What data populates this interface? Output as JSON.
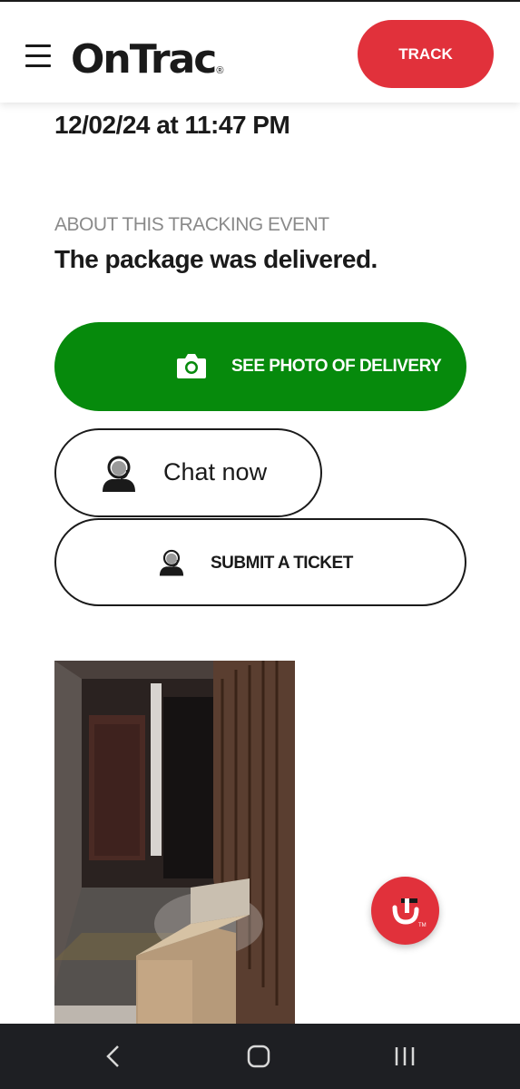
{
  "header": {
    "logo_text": "OnTrac",
    "logo_mark": "®",
    "track_label": "TRACK",
    "menu_icon": "hamburger-menu-icon"
  },
  "event": {
    "timestamp": "12/02/24 at 11:47 PM",
    "about_label": "ABOUT THIS TRACKING EVENT",
    "description": "The package was delivered."
  },
  "actions": {
    "photo_label": "SEE PHOTO OF DELIVERY",
    "photo_icon": "camera-icon",
    "chat_label": "Chat now",
    "chat_icon": "support-agent-icon",
    "ticket_label": "SUBMIT A TICKET",
    "ticket_icon": "support-agent-icon"
  },
  "colors": {
    "brand_red": "#e1313b",
    "green": "#068a0c",
    "text": "#1a1a1a",
    "muted": "#8a8a8a",
    "navbar": "#1e1f23"
  },
  "floating_button_icon": "ontrac-chat-icon",
  "system_nav": {
    "back_icon": "back-chevron-icon",
    "home_icon": "home-icon",
    "recents_icon": "recent-apps-icon"
  }
}
